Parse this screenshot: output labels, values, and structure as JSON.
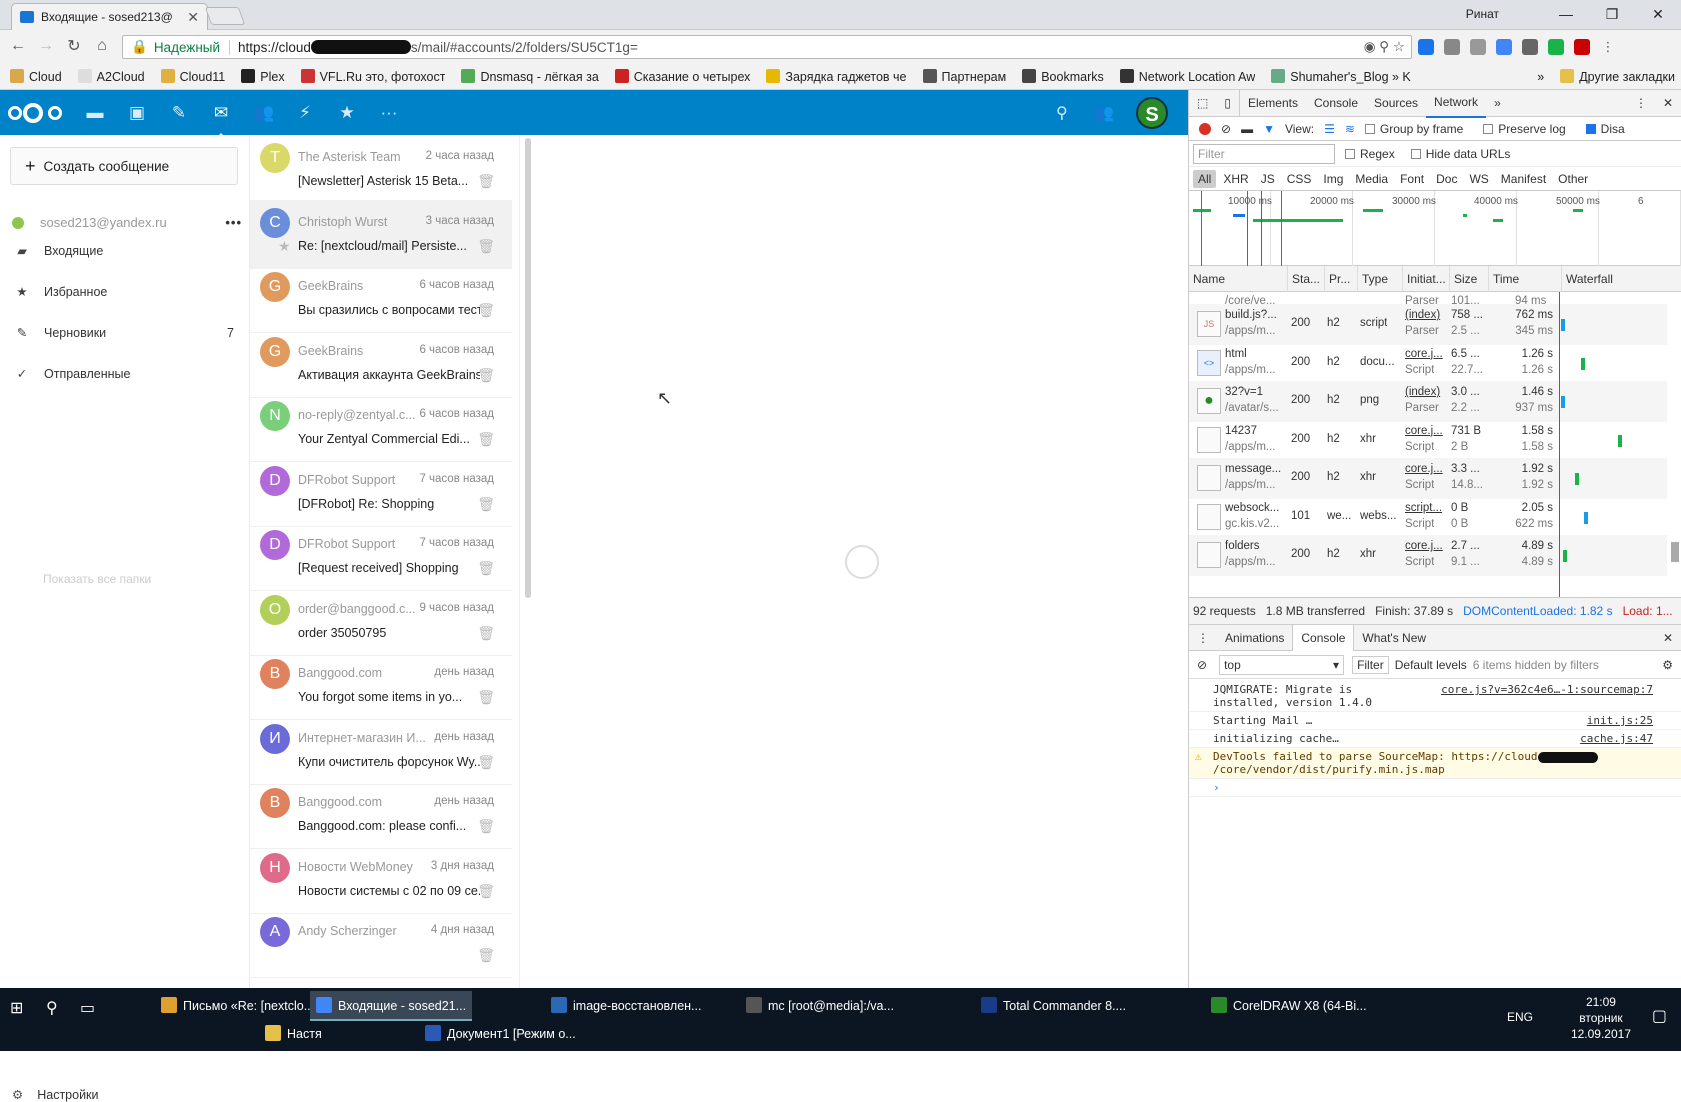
{
  "browser": {
    "tab_title": "Входящие - sosed213@",
    "user": "Ринат",
    "omnibox": {
      "secure_label": "Надежный",
      "url_prefix": "https://cloud",
      "url_suffix": "s/mail/#accounts/2/folders/SU5CT1g="
    },
    "bookmarks": [
      "Cloud",
      "A2Cloud",
      "Cloud11",
      "Plex",
      "VFL.Ru это, фотохост",
      "Dnsmasq - лёгкая за",
      "Сказание о четырех",
      "Зарядка гаджетов че",
      "Партнерам",
      "Bookmarks",
      "Network Location Aw",
      "Shumaher's_Blog » K"
    ],
    "bookmarks_overflow": "»",
    "other_bookmarks": "Другие закладки",
    "colors": {
      "tabbar": "#dee1e6",
      "secure": "#0b8043"
    }
  },
  "app": {
    "brand_color": "#0082c9",
    "compose_label": "Создать сообщение",
    "account": "sosed213@yandex.ru",
    "folders": [
      {
        "icon": "inbox-icon",
        "label": "Входящие",
        "count": ""
      },
      {
        "icon": "star-icon",
        "label": "Избранное",
        "count": ""
      },
      {
        "icon": "pencil-icon",
        "label": "Черновики",
        "count": "7"
      },
      {
        "icon": "check-icon",
        "label": "Отправленные",
        "count": ""
      }
    ],
    "show_all": "Показать все папки",
    "settings": "Настройки",
    "messages": [
      {
        "initial": "T",
        "color": "#d9d96a",
        "from": "The Asterisk Team",
        "when": "2 часа назад",
        "subject": "[Newsletter] Asterisk 15 Beta..."
      },
      {
        "initial": "C",
        "color": "#6a8ed9",
        "from": "Christoph Wurst",
        "when": "3 часа назад",
        "subject": "Re: [nextcloud/mail] Persiste..."
      },
      {
        "initial": "G",
        "color": "#e09a5e",
        "from": "GeekBrains",
        "when": "6 часов назад",
        "subject": "Вы сразились с вопросами тест..."
      },
      {
        "initial": "G",
        "color": "#e09a5e",
        "from": "GeekBrains",
        "when": "6 часов назад",
        "subject": "Активация аккаунта GeekBrains"
      },
      {
        "initial": "N",
        "color": "#7bcf7b",
        "from": "no-reply@zentyal.c...",
        "when": "6 часов назад",
        "subject": "Your Zentyal Commercial Edi..."
      },
      {
        "initial": "D",
        "color": "#b06ad9",
        "from": "DFRobot Support",
        "when": "7 часов назад",
        "subject": "[DFRobot] Re: Shopping"
      },
      {
        "initial": "D",
        "color": "#b06ad9",
        "from": "DFRobot Support",
        "when": "7 часов назад",
        "subject": "[Request received] Shopping"
      },
      {
        "initial": "O",
        "color": "#b2cf5a",
        "from": "order@banggood.c...",
        "when": "9 часов назад",
        "subject": "order 35050795"
      },
      {
        "initial": "B",
        "color": "#e0825e",
        "from": "Banggood.com",
        "when": "день назад",
        "subject": "You forgot some items in yo..."
      },
      {
        "initial": "И",
        "color": "#6a6ad9",
        "from": "Интернет-магазин И...",
        "when": "день назад",
        "subject": "Купи очиститель форсунок Wy..."
      },
      {
        "initial": "B",
        "color": "#e0825e",
        "from": "Banggood.com",
        "when": "день назад",
        "subject": "Banggood.com: please confi..."
      },
      {
        "initial": "Н",
        "color": "#e06a8a",
        "from": "Новости WebMoney",
        "when": "3 дня назад",
        "subject": "Новости системы с 02 по 09 се..."
      },
      {
        "initial": "A",
        "color": "#7a6ad9",
        "from": "Andy Scherzinger",
        "when": "4 дня назад",
        "subject": ""
      }
    ]
  },
  "devtools": {
    "tabs": [
      "Elements",
      "Console",
      "Sources",
      "Network",
      "»"
    ],
    "toolbar": {
      "view": "View:",
      "group_by_frame": "Group by frame",
      "preserve_log": "Preserve log",
      "disable": "Disa"
    },
    "filter_placeholder": "Filter",
    "regex": "Regex",
    "hide_data_urls": "Hide data URLs",
    "types": [
      "All",
      "XHR",
      "JS",
      "CSS",
      "Img",
      "Media",
      "Font",
      "Doc",
      "WS",
      "Manifest",
      "Other"
    ],
    "timeline_ticks": [
      "10000 ms",
      "20000 ms",
      "30000 ms",
      "40000 ms",
      "50000 ms",
      "6"
    ],
    "columns": [
      "Name",
      "Sta...",
      "Pr...",
      "Type",
      "Initiat...",
      "Size",
      "Time",
      "Waterfall"
    ],
    "partial_row": {
      "name": "/core/ve...",
      "initiator": "Parser",
      "size": "101...",
      "time": "94 ms"
    },
    "requests": [
      {
        "icon": "JS",
        "name": "build.js?...",
        "path": "/apps/m...",
        "status": "200",
        "proto": "h2",
        "type": "script",
        "init": "(index)",
        "init2": "Parser",
        "size": "758 ...",
        "size2": "2.5 ...",
        "time": "762 ms",
        "time2": "345 ms",
        "wf_color": "#1a9be8",
        "wf_offset": 0.02
      },
      {
        "icon": "<>",
        "name": "html",
        "path": "/apps/m...",
        "status": "200",
        "proto": "h2",
        "type": "docu...",
        "init": "core.j...",
        "init2": "Script",
        "size": "6.5 ...",
        "size2": "22.7...",
        "time": "1.26 s",
        "time2": "1.26 s",
        "wf_color": "#19b34a",
        "wf_offset": 0.24
      },
      {
        "icon": "img",
        "name": "32?v=1",
        "path": "/avatar/s...",
        "status": "200",
        "proto": "h2",
        "type": "png",
        "init": "(index)",
        "init2": "Parser",
        "size": "3.0 ...",
        "size2": "2.2 ...",
        "time": "1.46 s",
        "time2": "937 ms",
        "wf_color": "#1a9be8",
        "wf_offset": 0.02
      },
      {
        "icon": "",
        "name": "14237",
        "path": "/apps/m...",
        "status": "200",
        "proto": "h2",
        "type": "xhr",
        "init": "core.j...",
        "init2": "Script",
        "size": "731 B",
        "size2": "2 B",
        "time": "1.58 s",
        "time2": "1.58 s",
        "wf_color": "#19b34a",
        "wf_offset": 0.66
      },
      {
        "icon": "",
        "name": "message...",
        "path": "/apps/m...",
        "status": "200",
        "proto": "h2",
        "type": "xhr",
        "init": "core.j...",
        "init2": "Script",
        "size": "3.3 ...",
        "size2": "14.8...",
        "time": "1.92 s",
        "time2": "1.92 s",
        "wf_color": "#19b34a",
        "wf_offset": 0.18
      },
      {
        "icon": "",
        "name": "websock...",
        "path": "gc.kis.v2...",
        "status": "101",
        "proto": "we...",
        "type": "webs...",
        "init": "script...",
        "init2": "Script",
        "size": "0 B",
        "size2": "0 B",
        "time": "2.05 s",
        "time2": "622 ms",
        "wf_color": "#1a9be8",
        "wf_offset": 0.28
      },
      {
        "icon": "",
        "name": "folders",
        "path": "/apps/m...",
        "status": "200",
        "proto": "h2",
        "type": "xhr",
        "init": "core.j...",
        "init2": "Script",
        "size": "2.7 ...",
        "size2": "9.1 ...",
        "time": "4.89 s",
        "time2": "4.89 s",
        "wf_color": "#19b34a",
        "wf_offset": 0.04
      }
    ],
    "status": {
      "requests": "92 requests",
      "transferred": "1.8 MB transferred",
      "finish": "Finish: 37.89 s",
      "dcl": "DOMContentLoaded: 1.82 s",
      "load": "Load: 1..."
    },
    "drawer_tabs": [
      "Animations",
      "Console",
      "What's New"
    ],
    "console_context": "top",
    "console_filter": "Filter",
    "levels": "Default levels",
    "hidden": "6 items hidden by filters",
    "console_lines": [
      {
        "text": "JQMIGRATE: Migrate is installed, version 1.4.0",
        "src": "core.js?v=362c4e6…-1:sourcemap:7",
        "warn": false
      },
      {
        "text": "Starting Mail …",
        "src": "init.js:25",
        "warn": false
      },
      {
        "text": "initializing cache…",
        "src": "cache.js:47",
        "warn": false
      },
      {
        "text": "DevTools failed to parse SourceMap: https://cloud",
        "text2": "/core/vendor/dist/purify.min.js.map",
        "src": "",
        "warn": true
      }
    ],
    "prompt": "›"
  },
  "taskbar": {
    "row1": [
      "Письмо «Re: [nextclo...",
      "Входящие - sosed21...",
      "image-восстановлен...",
      "mc [root@media]:/va...",
      "Total Commander 8....",
      "CorelDRAW X8 (64-Bi..."
    ],
    "row2": [
      "Настя",
      "Документ1 [Режим о..."
    ],
    "lang": "ENG",
    "time": "21:09",
    "day": "вторник",
    "date": "12.09.2017"
  }
}
